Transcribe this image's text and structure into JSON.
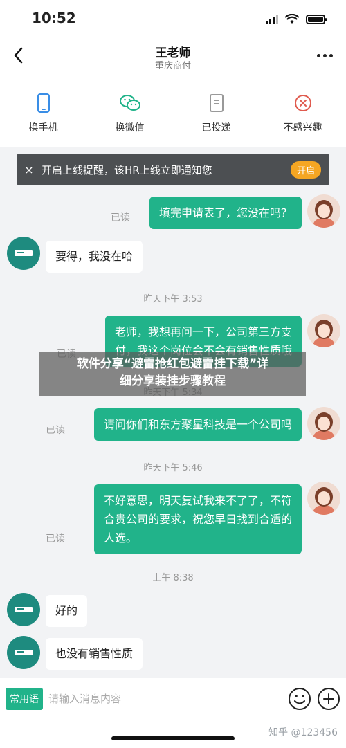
{
  "status_bar": {
    "time": "10:52"
  },
  "header": {
    "title": "王老师",
    "subtitle": "重庆商付"
  },
  "actions": [
    {
      "label": "换手机",
      "icon": "phone-icon",
      "color": "#3a8ee6"
    },
    {
      "label": "换微信",
      "icon": "wechat-icon",
      "color": "#21b38a"
    },
    {
      "label": "已投递",
      "icon": "document-icon",
      "color": "#999999"
    },
    {
      "label": "不感兴趣",
      "icon": "close-circle-icon",
      "color": "#e05b4f"
    }
  ],
  "notice": {
    "close": "×",
    "text": "开启上线提醒，该HR上线立即通知您",
    "button": "开启"
  },
  "messages": {
    "m1": {
      "read": "已读",
      "text": "填完申请表了，您没在吗？"
    },
    "m2": {
      "text": "要得，我没在哈"
    },
    "t1": "昨天下午 3:53",
    "m3": {
      "read": "已读",
      "line1": "老师，我想再问一下，公司第三方支",
      "line2": "付，我这个岗位会不会有销售性质哦"
    },
    "t2": "昨天下午 5:34",
    "m4": {
      "read": "已读",
      "text": "请问你们和东方聚星科技是一个公司吗"
    },
    "t3": "昨天下午 5:46",
    "m5": {
      "read": "已读",
      "line1": "不好意思，明天复试我来不了了，不符",
      "line2": "合贵公司的要求，祝您早日找到合适的",
      "line3": "人选。"
    },
    "t4": "上午 8:38",
    "m6": {
      "text": "好的"
    },
    "m7": {
      "text": "也没有销售性质"
    }
  },
  "overlay": {
    "line1": "软件分享“避雷抢红包避雷挂下载”详",
    "line2": "细分享装挂步骤教程"
  },
  "input_bar": {
    "quick": "常用语",
    "placeholder": "请输入消息内容"
  },
  "watermark": "知乎 @123456",
  "colors": {
    "accent": "#21b38a",
    "notice_bg": "#4c4f52",
    "notice_button": "#f5a623",
    "hr_avatar": "#1e8b7f"
  }
}
